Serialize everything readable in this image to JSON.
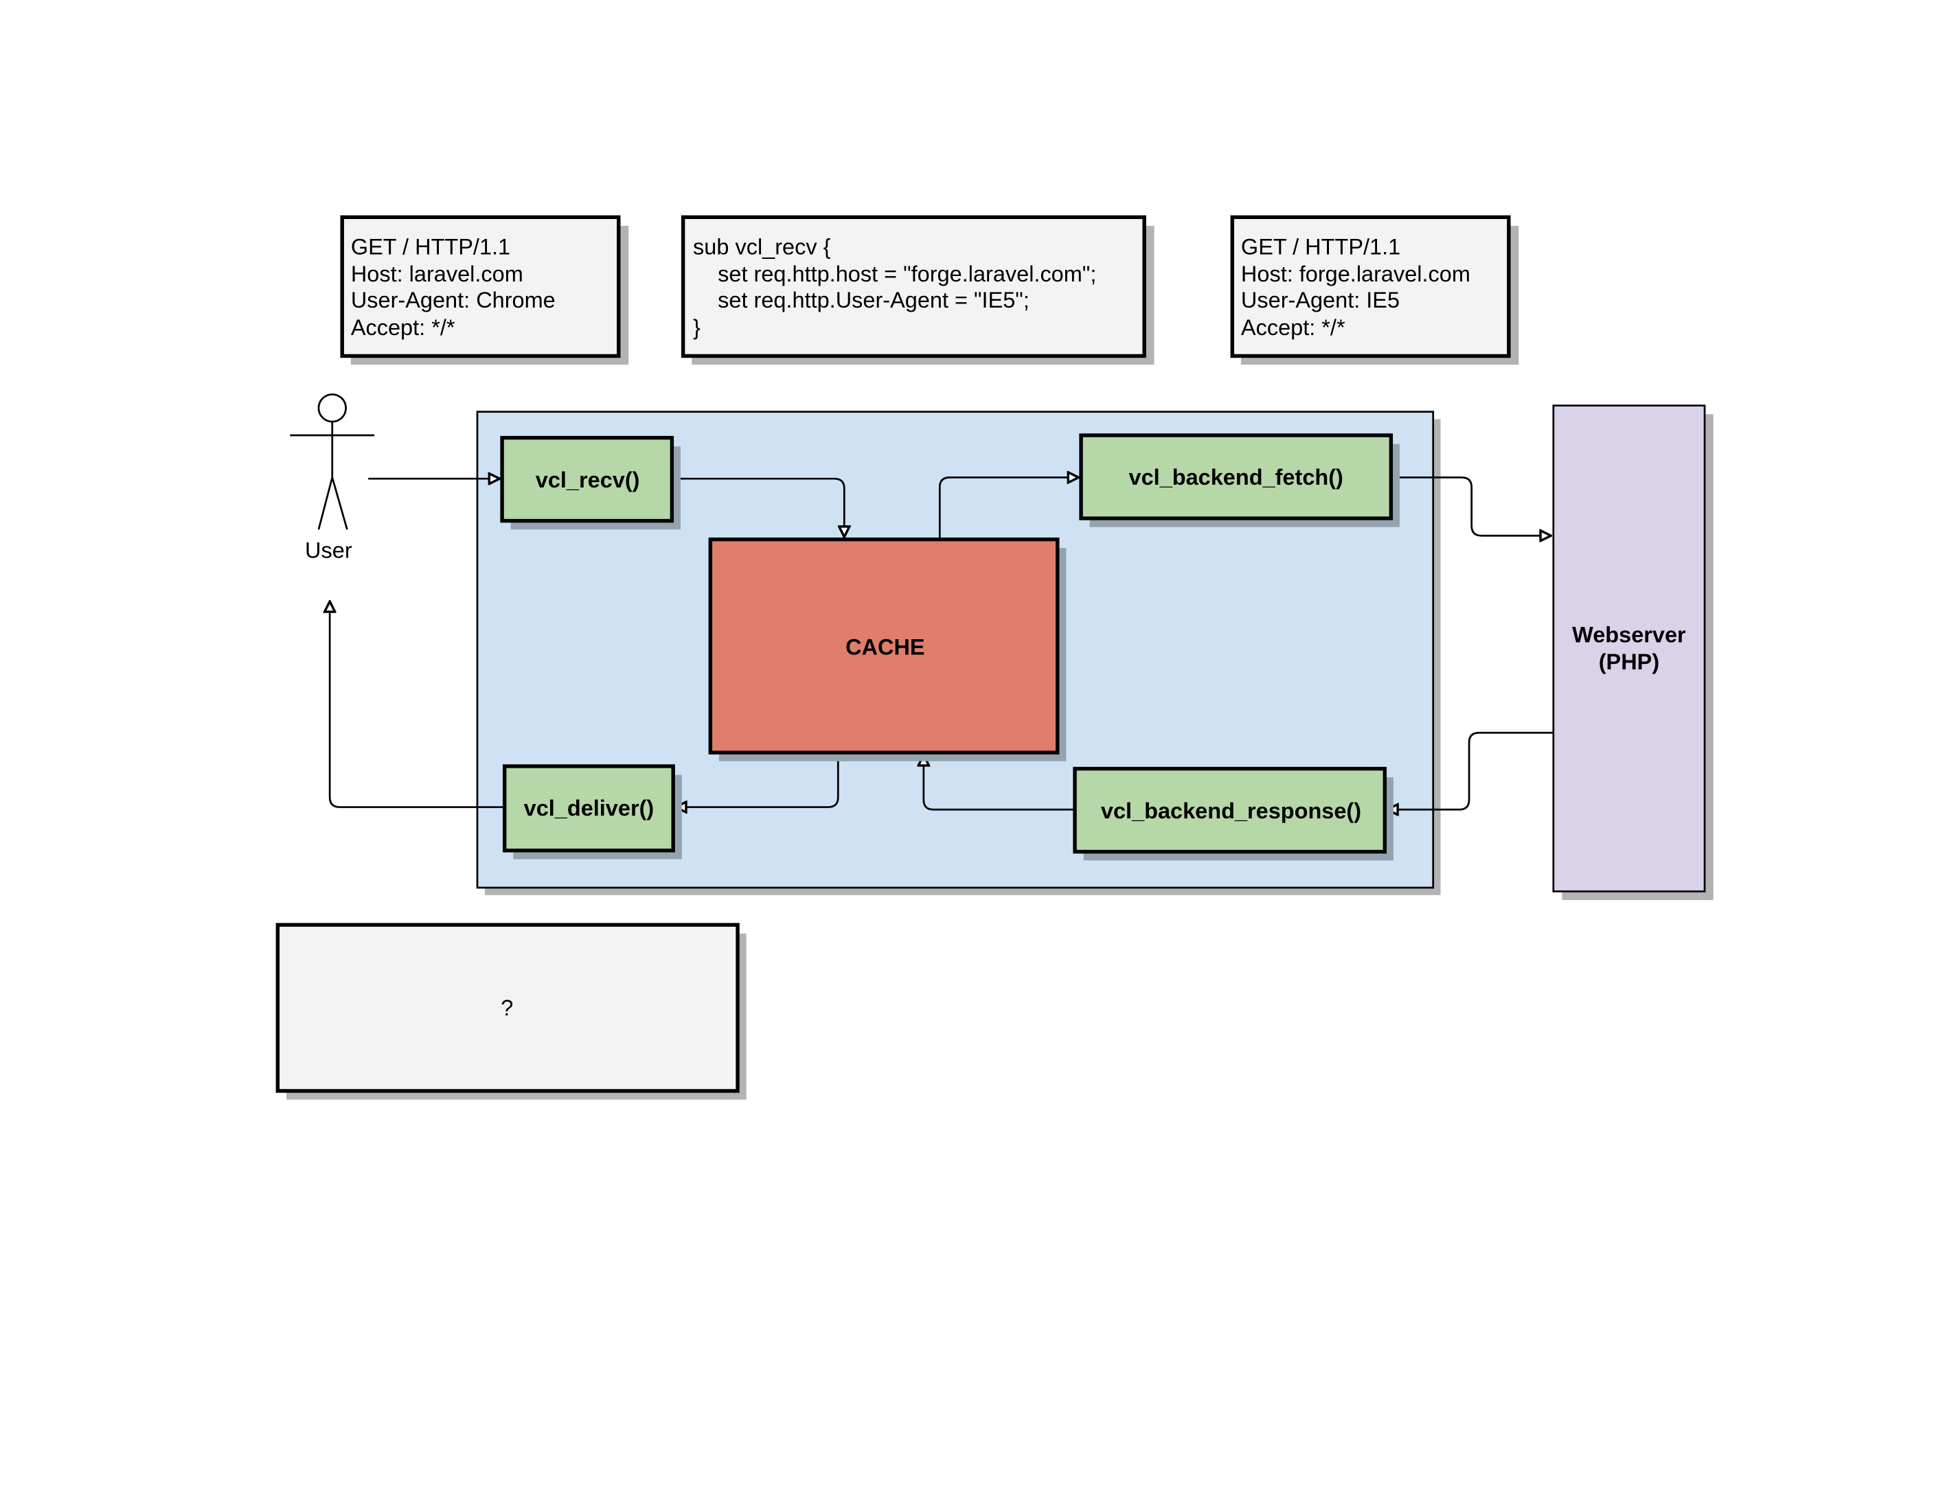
{
  "notes": {
    "request_in": [
      "GET / HTTP/1.1",
      "Host: laravel.com",
      "User-Agent: Chrome",
      "Accept: */*"
    ],
    "vcl_code": [
      "sub vcl_recv {",
      "    set req.http.host = \"forge.laravel.com\";",
      "    set req.http.User-Agent = \"IE5\";",
      "}"
    ],
    "request_out": [
      "GET / HTTP/1.1",
      "Host: forge.laravel.com",
      "User-Agent: IE5",
      "Accept: */*"
    ],
    "unknown": "?"
  },
  "actor": {
    "label": "User"
  },
  "nodes": {
    "vcl_recv": "vcl_recv()",
    "cache": "CACHE",
    "vcl_backend_fetch": "vcl_backend_fetch()",
    "vcl_deliver": "vcl_deliver()",
    "vcl_backend_response": "vcl_backend_response()",
    "webserver": [
      "Webserver",
      "(PHP)"
    ]
  },
  "colors": {
    "container": "#cfe2f3",
    "function_box": "#b6d7a8",
    "cache": "#e07e6c",
    "webserver": "#d9d2e9",
    "note": "#f3f3f3"
  }
}
